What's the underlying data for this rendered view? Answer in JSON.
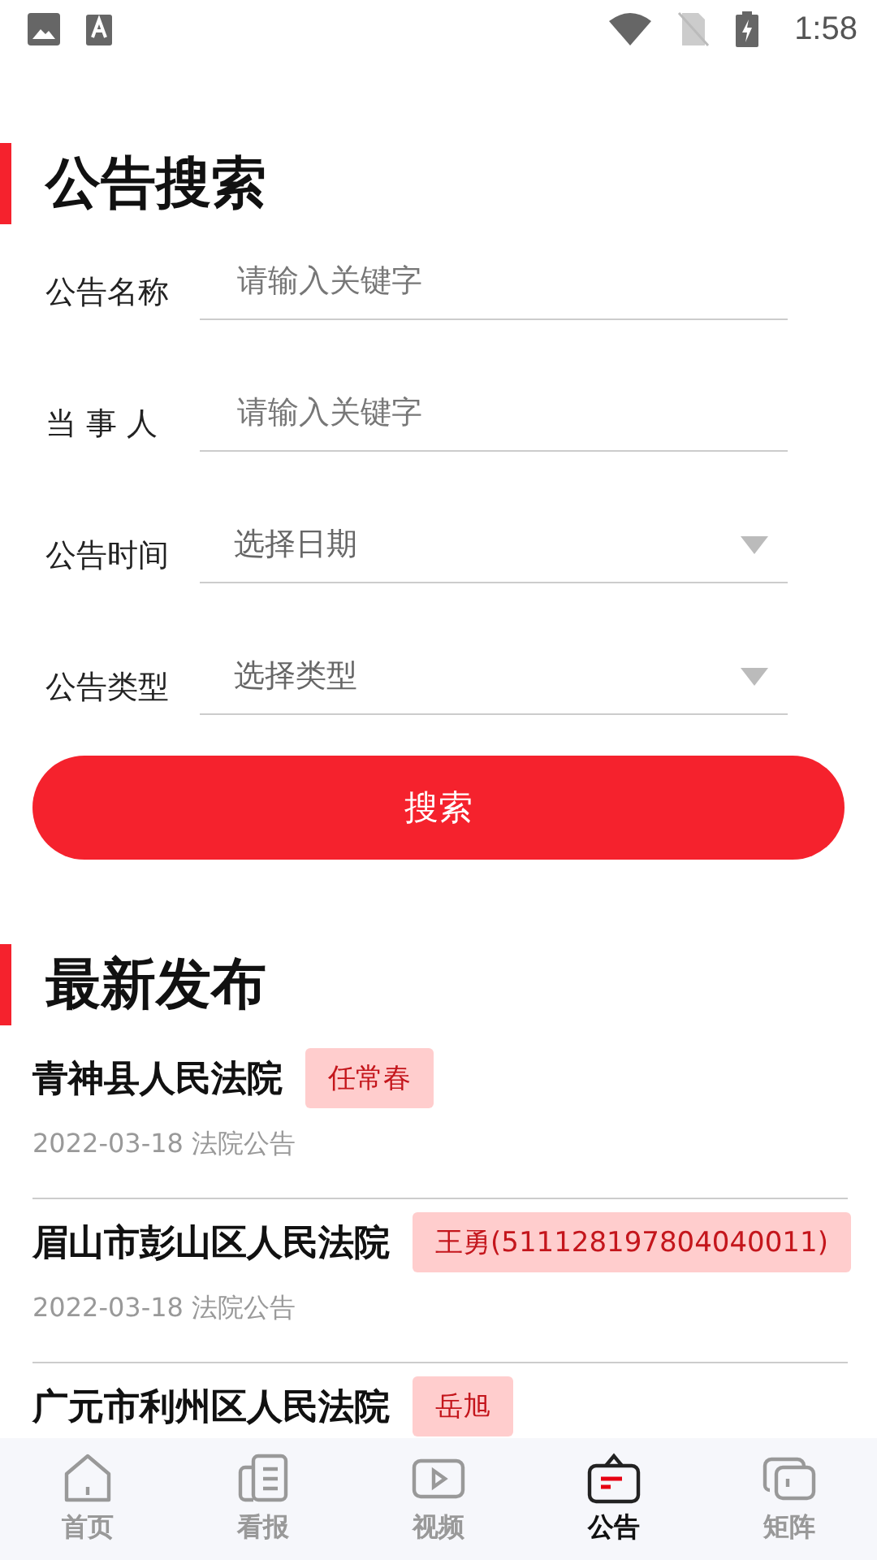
{
  "status_bar": {
    "time": "1:58"
  },
  "search_section": {
    "title": "公告搜索",
    "fields": [
      {
        "kind": "text",
        "label": "公告名称",
        "placeholder": "请输入关键字"
      },
      {
        "kind": "text",
        "label": "当 事 人",
        "placeholder": "请输入关键字"
      },
      {
        "kind": "select",
        "label": "公告时间",
        "placeholder": "选择日期"
      },
      {
        "kind": "select",
        "label": "公告类型",
        "placeholder": "选择类型"
      }
    ],
    "button": "搜索"
  },
  "latest_section": {
    "title": "最新发布",
    "items": [
      {
        "court": "青神县人民法院",
        "party": "任常春",
        "date": "2022-03-18",
        "type": "法院公告"
      },
      {
        "court": "眉山市彭山区人民法院",
        "party": "王勇(511128197804040011)",
        "date": "2022-03-18",
        "type": "法院公告"
      },
      {
        "court": "广元市利州区人民法院",
        "party": "岳旭"
      }
    ]
  },
  "bottom_nav": [
    {
      "kind": "home",
      "label": "首页",
      "selected": false
    },
    {
      "kind": "paper",
      "label": "看报",
      "selected": false
    },
    {
      "kind": "video",
      "label": "视频",
      "selected": false
    },
    {
      "kind": "notice",
      "label": "公告",
      "selected": true
    },
    {
      "kind": "matrix",
      "label": "矩阵",
      "selected": false
    }
  ]
}
